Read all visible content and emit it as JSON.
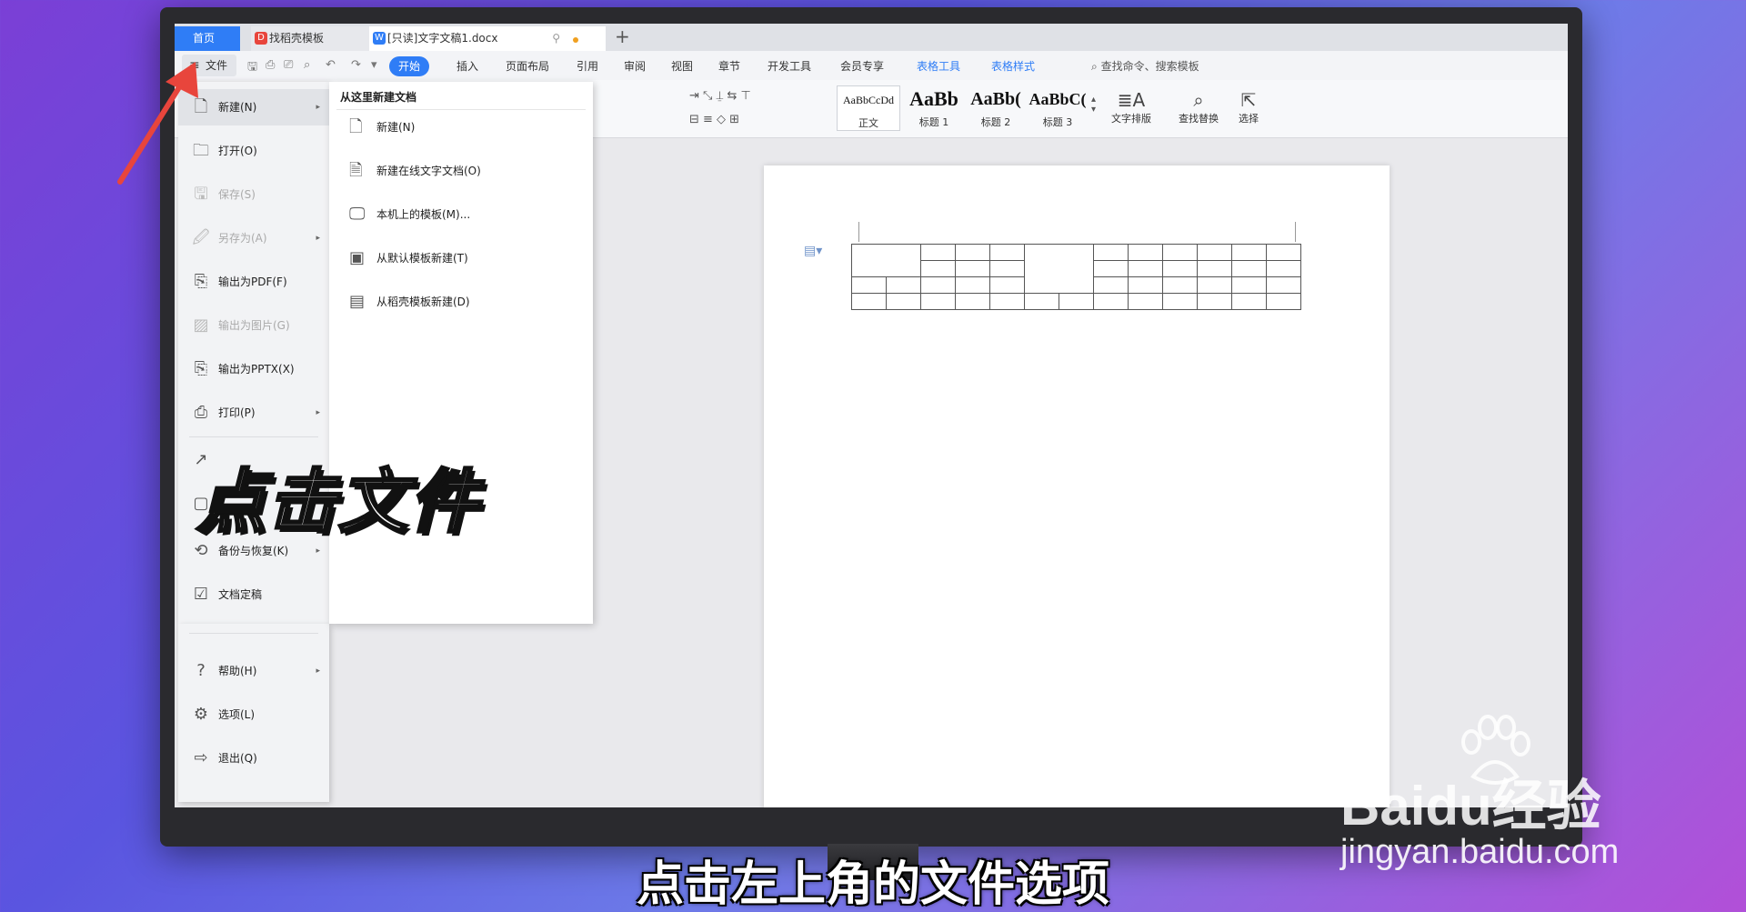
{
  "tabs": {
    "home": "首页",
    "template": "找稻壳模板",
    "document": "[只读]文字文稿1.docx",
    "add": "+"
  },
  "menubar": {
    "file_label": "文件",
    "tabs": [
      "开始",
      "插入",
      "页面布局",
      "引用",
      "审阅",
      "视图",
      "章节",
      "开发工具",
      "会员专享",
      "表格工具",
      "表格样式"
    ],
    "active_tab": "开始",
    "search_placeholder": "查找命令、搜索模板"
  },
  "toolbar": {
    "styles": [
      {
        "sample": "AaBbCcDd",
        "name": "正文"
      },
      {
        "sample": "AaBb",
        "name": "标题 1"
      },
      {
        "sample": "AaBb(",
        "name": "标题 2"
      },
      {
        "sample": "AaBbC(",
        "name": "标题 3"
      }
    ],
    "text_layout": "文字排版",
    "find_replace": "查找替换",
    "select": "选择"
  },
  "file_menu": {
    "items": [
      {
        "label": "新建(N)",
        "icon": "new-doc-icon",
        "arrow": true,
        "disabled": false
      },
      {
        "label": "打开(O)",
        "icon": "folder-icon",
        "arrow": false,
        "disabled": false
      },
      {
        "label": "保存(S)",
        "icon": "save-icon",
        "arrow": false,
        "disabled": true
      },
      {
        "label": "另存为(A)",
        "icon": "save-as-icon",
        "arrow": true,
        "disabled": true
      },
      {
        "label": "输出为PDF(F)",
        "icon": "pdf-icon",
        "arrow": false,
        "disabled": false
      },
      {
        "label": "输出为图片(G)",
        "icon": "image-icon",
        "arrow": false,
        "disabled": true
      },
      {
        "label": "输出为PPTX(X)",
        "icon": "pptx-icon",
        "arrow": false,
        "disabled": false
      },
      {
        "label": "打印(P)",
        "icon": "print-icon",
        "arrow": true,
        "disabled": false
      },
      {
        "label": "备份与恢复(K)",
        "icon": "backup-icon",
        "arrow": true,
        "disabled": false
      },
      {
        "label": "文档定稿",
        "icon": "finalize-icon",
        "arrow": false,
        "disabled": false
      },
      {
        "label": "帮助(H)",
        "icon": "help-icon",
        "arrow": true,
        "disabled": false
      },
      {
        "label": "选项(L)",
        "icon": "gear-icon",
        "arrow": false,
        "disabled": false
      },
      {
        "label": "退出(Q)",
        "icon": "exit-icon",
        "arrow": false,
        "disabled": false
      }
    ]
  },
  "sub_menu": {
    "title": "从这里新建文档",
    "items": [
      {
        "label": "新建(N)",
        "icon": "new-doc-icon"
      },
      {
        "label": "新建在线文字文档(O)",
        "icon": "online-doc-icon"
      },
      {
        "label": "本机上的模板(M)...",
        "icon": "local-template-icon"
      },
      {
        "label": "从默认模板新建(T)",
        "icon": "default-template-icon"
      },
      {
        "label": "从稻壳模板新建(D)",
        "icon": "docer-template-icon"
      }
    ]
  },
  "overlay": {
    "caption": "点击文件",
    "subtitle": "点击左上角的文件选项"
  },
  "watermark": {
    "logo": "Baidu经验",
    "url": "jingyan.baidu.com"
  },
  "colors": {
    "accent": "#2f7df6",
    "arrow": "#e8453c"
  }
}
